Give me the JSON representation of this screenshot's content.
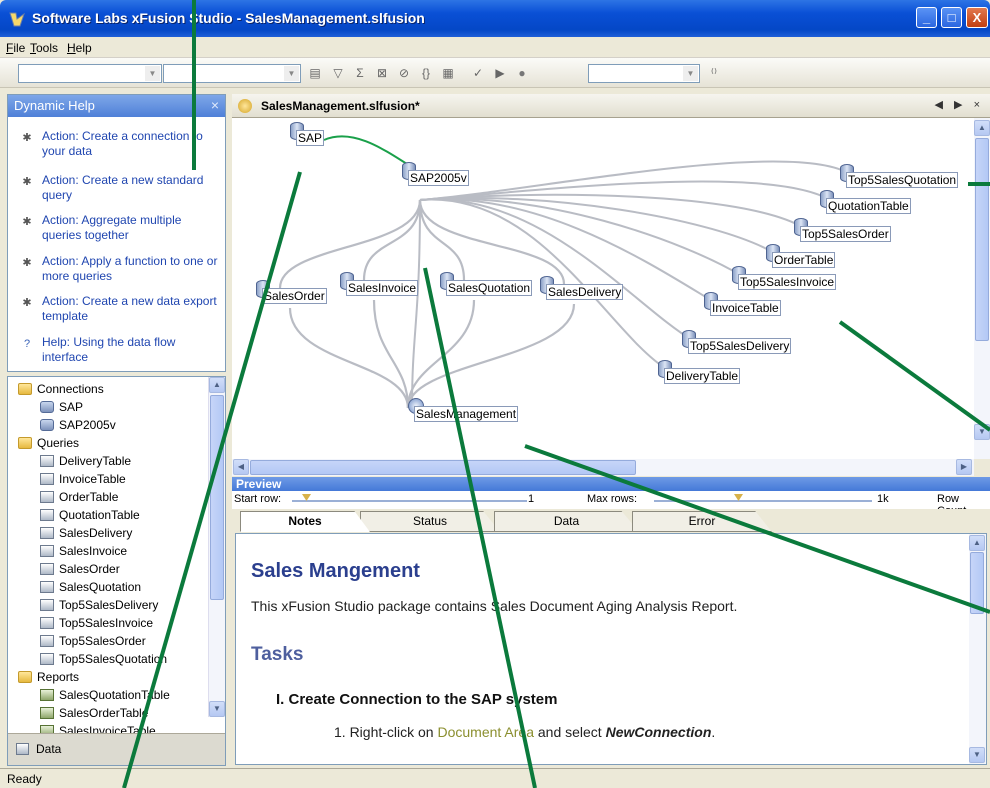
{
  "window": {
    "title": "Software Labs xFusion Studio - SalesManagement.slfusion",
    "min": "_",
    "max": "□",
    "close": "X"
  },
  "menu": [
    "File",
    "Tools",
    "Help"
  ],
  "help": {
    "title": "Dynamic Help",
    "close": "×",
    "items": [
      {
        "text": "Action: Create a connection to your data",
        "icon": "action-icon"
      },
      {
        "text": "Action: Create a new standard query",
        "icon": "action-icon"
      },
      {
        "text": "Action: Aggregate multiple queries together",
        "icon": "action-icon"
      },
      {
        "text": "Action: Apply a function to one or more queries",
        "icon": "action-icon"
      },
      {
        "text": "Action: Create a new data export template",
        "icon": "action-icon"
      },
      {
        "text": "Help: Using the data flow interface",
        "icon": "help-icon"
      }
    ]
  },
  "tree": {
    "connections_label": "Connections",
    "connections": [
      "SAP",
      "SAP2005v"
    ],
    "queries_label": "Queries",
    "queries": [
      "DeliveryTable",
      "InvoiceTable",
      "OrderTable",
      "QuotationTable",
      "SalesDelivery",
      "SalesInvoice",
      "SalesOrder",
      "SalesQuotation",
      "Top5SalesDelivery",
      "Top5SalesInvoice",
      "Top5SalesOrder",
      "Top5SalesQuotation"
    ],
    "reports_label": "Reports",
    "reports": [
      "SalesQuotationTable",
      "SalesOrderTable",
      "SalesInvoiceTable"
    ],
    "bottom_tab": "Data"
  },
  "document": {
    "tab": "SalesManagement.slfusion*",
    "nav": "◀ ▶ ×"
  },
  "canvas": {
    "nodes": {
      "sap": "SAP",
      "sap2005v": "SAP2005v",
      "salesorder": "SalesOrder",
      "salesinvoice": "SalesInvoice",
      "salesquotation": "SalesQuotation",
      "salesdelivery": "SalesDelivery",
      "salesmanagement": "SalesManagement",
      "top5salesquotation": "Top5SalesQuotation",
      "quotationtable": "QuotationTable",
      "top5salesorder": "Top5SalesOrder",
      "ordertable": "OrderTable",
      "top5salesinvoice": "Top5SalesInvoice",
      "invoicetable": "InvoiceTable",
      "top5salesdelivery": "Top5SalesDelivery",
      "deliverytable": "DeliveryTable"
    }
  },
  "preview": {
    "title": "Preview",
    "start_row_label": "Start row:",
    "start_row_value": "1",
    "max_rows_label": "Max rows:",
    "max_rows_value": "1k",
    "row_count_label": "Row Count"
  },
  "tabs": [
    "Notes",
    "Status",
    "Data",
    "Error"
  ],
  "notes": {
    "heading": "Sales Mangement",
    "intro": "This xFusion Studio package contains Sales Document Aging Analysis Report.",
    "tasks": "Tasks",
    "step_title": "I. Create Connection to the SAP system",
    "step1_pre": "1.   Right-click on ",
    "step1_link": "Document Area",
    "step1_mid": "  and select ",
    "step1_bold": "NewConnection",
    "step1_end": "."
  },
  "status": "Ready",
  "colors": {
    "title_blue": "#0a50d6",
    "callout_green": "#0b7a3c",
    "edge_gray": "#b9bcc4",
    "edge_green": "#1aa04a"
  }
}
